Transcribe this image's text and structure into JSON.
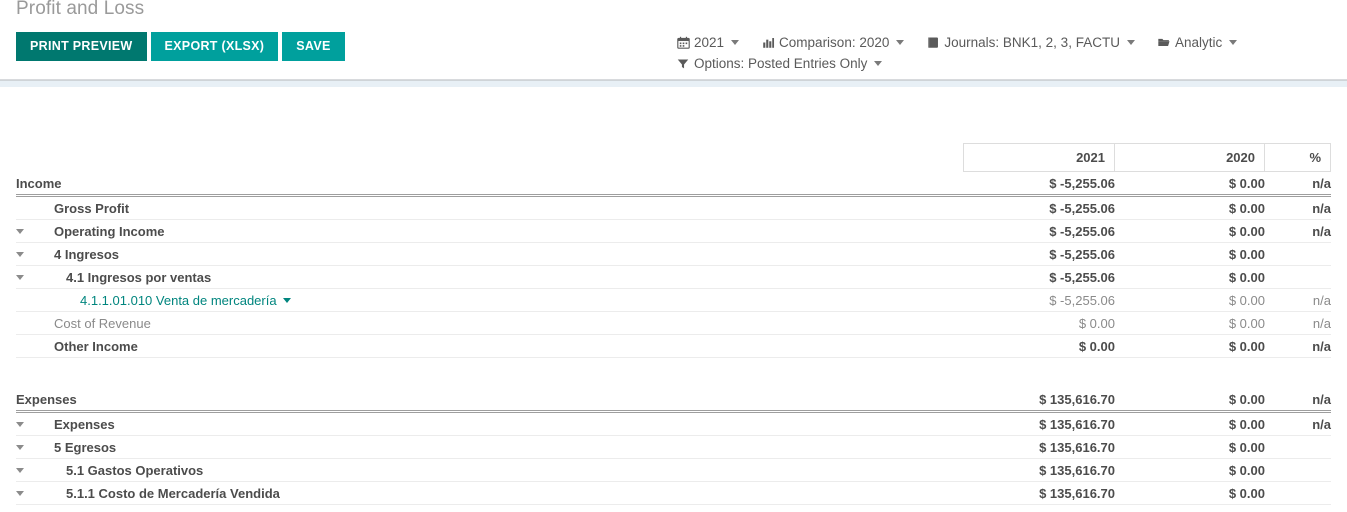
{
  "breadcrumb": "Profit and Loss",
  "buttons": {
    "print_preview": "PRINT PREVIEW",
    "export": "EXPORT (XLSX)",
    "save": "SAVE"
  },
  "colors": {
    "primary": "#00786f",
    "secondary": "#00a09d",
    "link": "#00857e",
    "band": "#e8f0f6"
  },
  "filters": [
    {
      "icon": "calendar-icon",
      "label": "2021"
    },
    {
      "icon": "bar-chart-icon",
      "label": "Comparison: 2020"
    },
    {
      "icon": "book-icon",
      "label": "Journals: BNK1, 2, 3, FACTU"
    },
    {
      "icon": "folder-open-icon",
      "label": "Analytic"
    },
    {
      "icon": "filter-icon",
      "label": "Options: Posted Entries Only"
    }
  ],
  "table": {
    "headers": {
      "col1": "2021",
      "col2": "2020",
      "col3": "%"
    },
    "sections": [
      {
        "title": "Income",
        "head_values": {
          "v1": "$ -5,255.06",
          "v2": "$ 0.00",
          "pct": "n/a"
        },
        "rows": [
          {
            "label": "Gross Profit",
            "indent": 2,
            "toggle": false,
            "bold": true,
            "link": false,
            "v1": "$ -5,255.06",
            "v2": "$ 0.00",
            "pct": "n/a"
          },
          {
            "label": "Operating Income",
            "indent": 2,
            "toggle": true,
            "bold": true,
            "link": false,
            "v1": "$ -5,255.06",
            "v2": "$ 0.00",
            "pct": "n/a"
          },
          {
            "label": "4 Ingresos",
            "indent": 3,
            "toggle": true,
            "bold": true,
            "link": false,
            "v1": "$ -5,255.06",
            "v2": "$ 0.00",
            "pct": ""
          },
          {
            "label": "4.1 Ingresos por ventas",
            "indent": 4,
            "toggle": true,
            "bold": true,
            "link": false,
            "v1": "$ -5,255.06",
            "v2": "$ 0.00",
            "pct": ""
          },
          {
            "label": "4.1.1.01.010 Venta de mercadería",
            "indent": 5,
            "toggle": false,
            "bold": false,
            "link": true,
            "v1": "$ -5,255.06",
            "v2": "$ 0.00",
            "pct": "n/a"
          },
          {
            "label": "Cost of Revenue",
            "indent": 2,
            "toggle": false,
            "bold": false,
            "link": false,
            "muted": true,
            "v1": "$ 0.00",
            "v2": "$ 0.00",
            "pct": "n/a"
          },
          {
            "label": "Other Income",
            "indent": 2,
            "toggle": false,
            "bold": true,
            "link": false,
            "v1": "$ 0.00",
            "v2": "$ 0.00",
            "pct": "n/a"
          }
        ]
      },
      {
        "title": "Expenses",
        "head_values": {
          "v1": "$ 135,616.70",
          "v2": "$ 0.00",
          "pct": "n/a"
        },
        "rows": [
          {
            "label": "Expenses",
            "indent": 2,
            "toggle": true,
            "bold": true,
            "link": false,
            "v1": "$ 135,616.70",
            "v2": "$ 0.00",
            "pct": "n/a"
          },
          {
            "label": "5 Egresos",
            "indent": 3,
            "toggle": true,
            "bold": true,
            "link": false,
            "v1": "$ 135,616.70",
            "v2": "$ 0.00",
            "pct": ""
          },
          {
            "label": "5.1 Gastos Operativos",
            "indent": 4,
            "toggle": true,
            "bold": true,
            "link": false,
            "v1": "$ 135,616.70",
            "v2": "$ 0.00",
            "pct": ""
          },
          {
            "label": "5.1.1 Costo de Mercadería Vendida",
            "indent": 5,
            "toggle": true,
            "bold": true,
            "link": false,
            "v1": "$ 135,616.70",
            "v2": "$ 0.00",
            "pct": ""
          }
        ]
      }
    ]
  }
}
